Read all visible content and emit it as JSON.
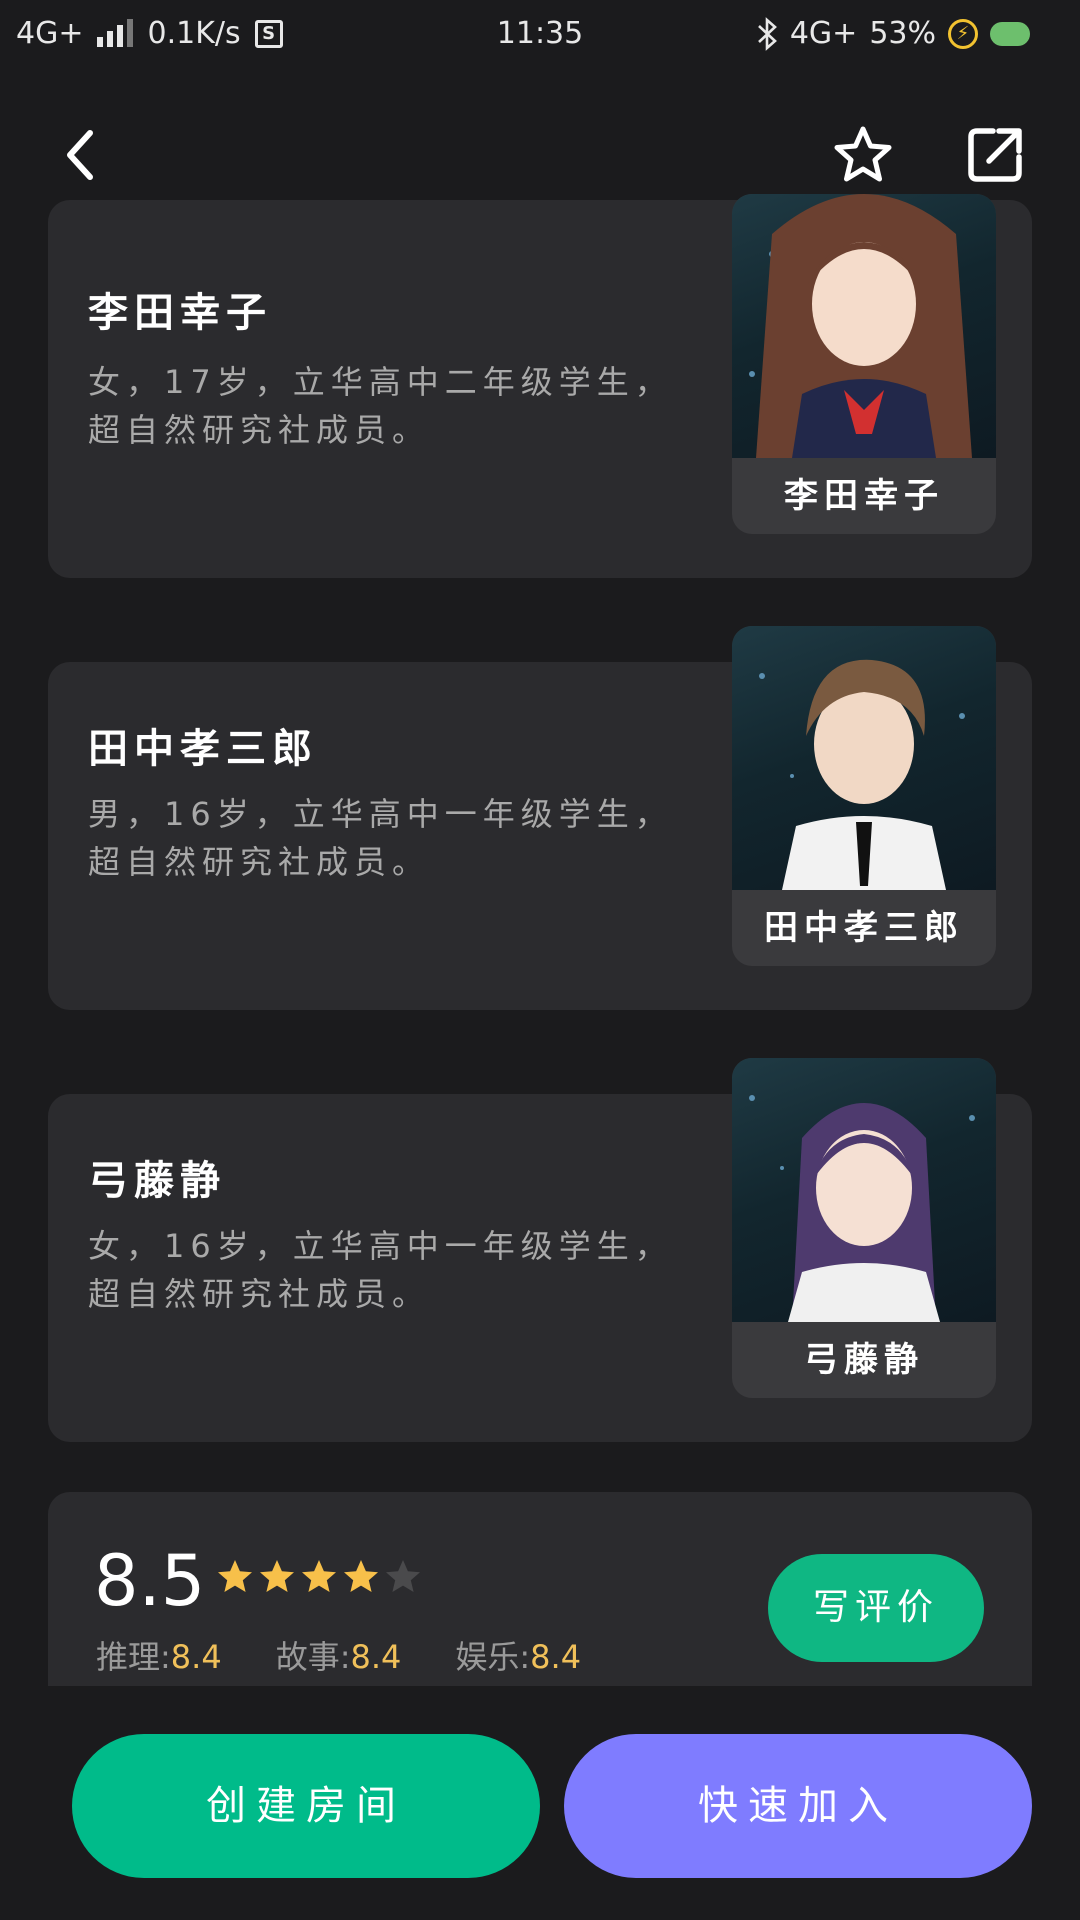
{
  "status_bar": {
    "network_left": "4G+",
    "speed": "0.1K/s",
    "s_icon": "S",
    "time": "11:35",
    "network_right": "4G+",
    "battery": "53%"
  },
  "nav": {
    "back_icon": "chevron-left-icon",
    "favorite_icon": "star-outline-icon",
    "share_icon": "share-icon"
  },
  "characters": [
    {
      "name": "李田幸子",
      "description": "女，17岁，立华高中二年级学生，超自然研究社成员。",
      "portrait_label": "李田幸子",
      "hair_color": "#6b4030"
    },
    {
      "name": "田中孝三郎",
      "description": "男，16岁，立华高中一年级学生，超自然研究社成员。",
      "portrait_label": "田中孝三郎",
      "hair_color": "#7a5a40"
    },
    {
      "name": "弓藤静",
      "description": "女，16岁，立华高中一年级学生，超自然研究社成员。",
      "portrait_label": "弓藤静",
      "hair_color": "#4e3a6e"
    }
  ],
  "rating": {
    "score": "8.5",
    "stars_filled": 4,
    "stars_total": 5,
    "sub_scores": [
      {
        "label": "推理:",
        "value": "8.4"
      },
      {
        "label": "故事:",
        "value": "8.4"
      },
      {
        "label": "娱乐:",
        "value": "8.4"
      }
    ],
    "review_button": "写评价"
  },
  "actions": {
    "create_room": "创建房间",
    "quick_join": "快速加入"
  },
  "colors": {
    "background": "#1b1b1d",
    "card": "#2b2b2e",
    "green": "#00bb8a",
    "purple": "#7f7cff",
    "star": "#f7c04a",
    "sub_value": "#f0c05a"
  }
}
